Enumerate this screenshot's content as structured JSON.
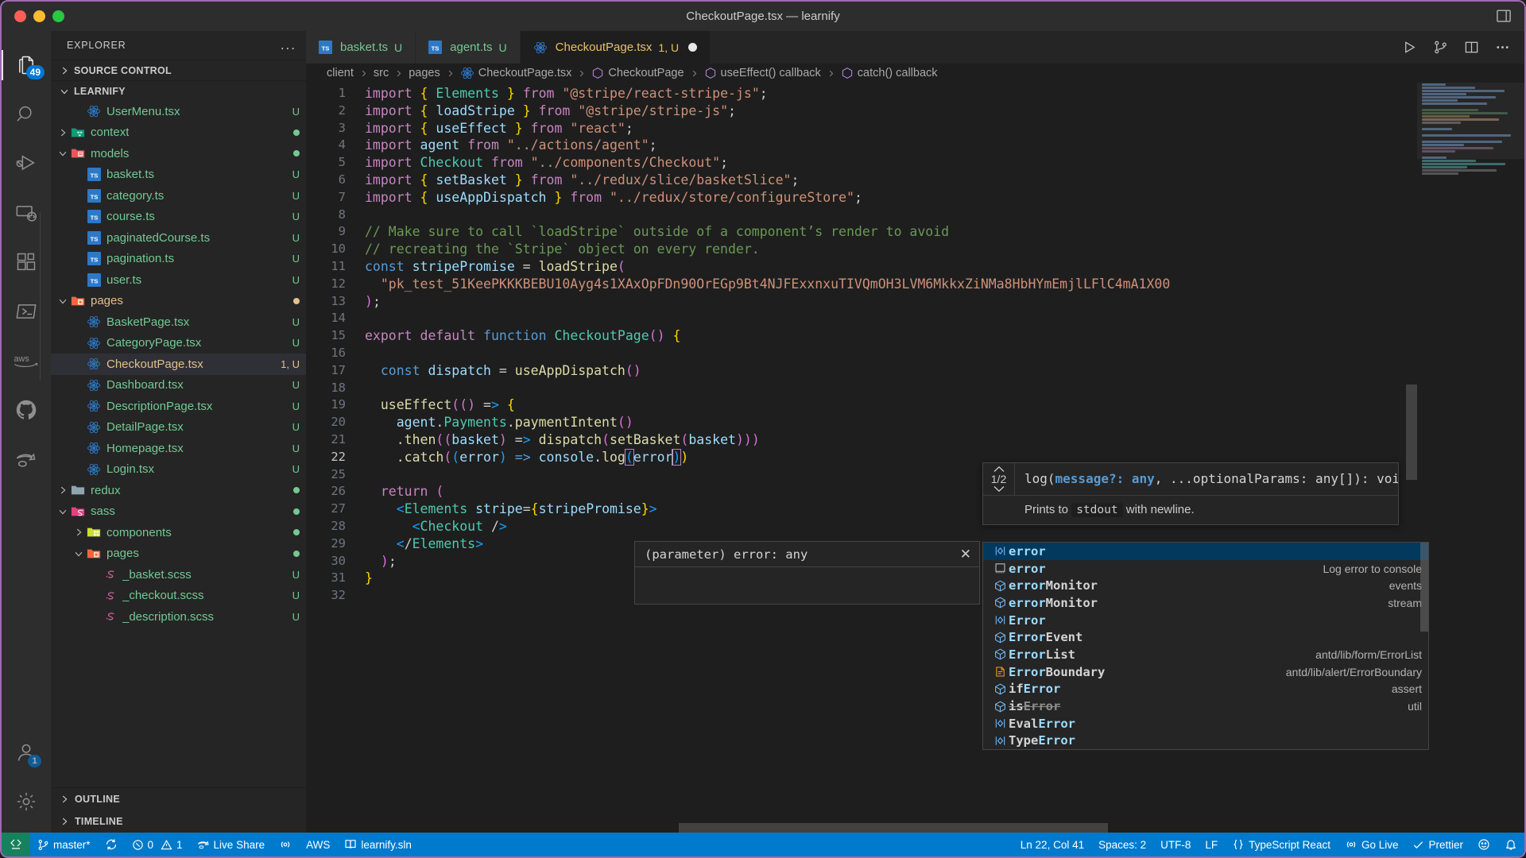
{
  "window": {
    "title": "CheckoutPage.tsx — learnify",
    "traffic_lights": [
      "close",
      "minimize",
      "zoom"
    ],
    "layout_icon": "editor-layout-icon"
  },
  "activitybar": {
    "items": [
      {
        "name": "explorer",
        "icon": "files-icon",
        "badge": "49",
        "active": true
      },
      {
        "name": "search",
        "icon": "search-icon",
        "badge": ""
      },
      {
        "name": "run-and-debug",
        "icon": "debug-icon",
        "badge": ""
      },
      {
        "name": "remote-explorer",
        "icon": "remote-icon",
        "badge": ""
      },
      {
        "name": "extensions",
        "icon": "extensions-icon",
        "badge": ""
      },
      {
        "name": "terminal-tools",
        "icon": "powershell-icon",
        "badge": ""
      },
      {
        "name": "aws-toolkit",
        "icon": "aws-icon",
        "badge": ""
      },
      {
        "name": "github",
        "icon": "github-icon",
        "badge": ""
      },
      {
        "name": "live-share",
        "icon": "live-share-icon",
        "badge": ""
      }
    ],
    "bottom": [
      {
        "name": "accounts",
        "icon": "account-icon",
        "badge": "1"
      },
      {
        "name": "manage-settings",
        "icon": "gear-icon",
        "badge": ""
      }
    ]
  },
  "sidebar": {
    "title": "EXPLORER",
    "more_actions": "...",
    "sections": [
      {
        "label": "SOURCE CONTROL",
        "expanded": false
      },
      {
        "label": "LEARNIFY",
        "expanded": true
      }
    ],
    "tree": [
      {
        "label": "UserMenu.tsx",
        "icon": "react-icon",
        "indent": 3,
        "twisty": "",
        "status": "U",
        "color": "green"
      },
      {
        "label": "context",
        "icon": "folder-context-icon",
        "indent": 2,
        "twisty": "collapsed",
        "status": "dot",
        "color": "green"
      },
      {
        "label": "models",
        "icon": "folder-models-icon",
        "indent": 2,
        "twisty": "expanded",
        "status": "dot",
        "color": "green"
      },
      {
        "label": "basket.ts",
        "icon": "ts-icon",
        "indent": 3,
        "twisty": "",
        "status": "U",
        "color": "green"
      },
      {
        "label": "category.ts",
        "icon": "ts-icon",
        "indent": 3,
        "twisty": "",
        "status": "U",
        "color": "green"
      },
      {
        "label": "course.ts",
        "icon": "ts-icon",
        "indent": 3,
        "twisty": "",
        "status": "U",
        "color": "green"
      },
      {
        "label": "paginatedCourse.ts",
        "icon": "ts-icon",
        "indent": 3,
        "twisty": "",
        "status": "U",
        "color": "green"
      },
      {
        "label": "pagination.ts",
        "icon": "ts-icon",
        "indent": 3,
        "twisty": "",
        "status": "U",
        "color": "green"
      },
      {
        "label": "user.ts",
        "icon": "ts-icon",
        "indent": 3,
        "twisty": "",
        "status": "U",
        "color": "green"
      },
      {
        "label": "pages",
        "icon": "folder-pages-icon",
        "indent": 2,
        "twisty": "expanded",
        "status": "dot-orange",
        "color": "orange"
      },
      {
        "label": "BasketPage.tsx",
        "icon": "react-icon",
        "indent": 3,
        "twisty": "",
        "status": "U",
        "color": "green"
      },
      {
        "label": "CategoryPage.tsx",
        "icon": "react-icon",
        "indent": 3,
        "twisty": "",
        "status": "U",
        "color": "green"
      },
      {
        "label": "CheckoutPage.tsx",
        "icon": "react-icon",
        "indent": 3,
        "twisty": "",
        "status": "1, U",
        "color": "orange",
        "selected": true
      },
      {
        "label": "Dashboard.tsx",
        "icon": "react-icon",
        "indent": 3,
        "twisty": "",
        "status": "U",
        "color": "green"
      },
      {
        "label": "DescriptionPage.tsx",
        "icon": "react-icon",
        "indent": 3,
        "twisty": "",
        "status": "U",
        "color": "green"
      },
      {
        "label": "DetailPage.tsx",
        "icon": "react-icon",
        "indent": 3,
        "twisty": "",
        "status": "U",
        "color": "green"
      },
      {
        "label": "Homepage.tsx",
        "icon": "react-icon",
        "indent": 3,
        "twisty": "",
        "status": "U",
        "color": "green"
      },
      {
        "label": "Login.tsx",
        "icon": "react-icon",
        "indent": 3,
        "twisty": "",
        "status": "U",
        "color": "green"
      },
      {
        "label": "redux",
        "icon": "folder-plain-icon",
        "indent": 2,
        "twisty": "collapsed",
        "status": "dot",
        "color": "green"
      },
      {
        "label": "sass",
        "icon": "folder-sass-icon",
        "indent": 2,
        "twisty": "expanded",
        "status": "dot",
        "color": "green"
      },
      {
        "label": "components",
        "icon": "folder-components-icon",
        "indent": 3,
        "twisty": "collapsed",
        "status": "dot",
        "color": "green"
      },
      {
        "label": "pages",
        "icon": "folder-pages2-icon",
        "indent": 3,
        "twisty": "expanded",
        "status": "dot",
        "color": "green"
      },
      {
        "label": "_basket.scss",
        "icon": "sass-icon",
        "indent": 4,
        "twisty": "",
        "status": "U",
        "color": "green"
      },
      {
        "label": "_checkout.scss",
        "icon": "sass-icon",
        "indent": 4,
        "twisty": "",
        "status": "U",
        "color": "green"
      },
      {
        "label": "_description.scss",
        "icon": "sass-icon",
        "indent": 4,
        "twisty": "",
        "status": "U",
        "color": "green"
      }
    ],
    "footer": [
      {
        "label": "OUTLINE",
        "expanded": false
      },
      {
        "label": "TIMELINE",
        "expanded": false
      }
    ]
  },
  "tabs": {
    "items": [
      {
        "name": "basket.ts",
        "icon": "ts-icon",
        "status": "U",
        "active": false,
        "dirty": false
      },
      {
        "name": "agent.ts",
        "icon": "ts-icon",
        "status": "U",
        "active": false,
        "dirty": false
      },
      {
        "name": "CheckoutPage.tsx",
        "icon": "react-icon",
        "status": "1, U",
        "active": true,
        "dirty": true
      }
    ],
    "actions": [
      {
        "name": "run-code-button",
        "icon": "play-icon"
      },
      {
        "name": "source-control-button",
        "icon": "branch-icon"
      },
      {
        "name": "split-editor-button",
        "icon": "split-icon"
      },
      {
        "name": "more-actions-button",
        "icon": "ellipsis-icon"
      }
    ]
  },
  "breadcrumb": [
    {
      "label": "client",
      "icon": ""
    },
    {
      "label": "src",
      "icon": ""
    },
    {
      "label": "pages",
      "icon": ""
    },
    {
      "label": "CheckoutPage.tsx",
      "icon": "react-icon"
    },
    {
      "label": "CheckoutPage",
      "icon": "symbol-function-icon"
    },
    {
      "label": "useEffect() callback",
      "icon": "symbol-function-icon"
    },
    {
      "label": "catch() callback",
      "icon": "symbol-function-icon"
    }
  ],
  "code": {
    "lines": [
      {
        "n": "1",
        "text": "import { Elements } from \"@stripe/react-stripe-js\";"
      },
      {
        "n": "2",
        "text": "import { loadStripe } from \"@stripe/stripe-js\";"
      },
      {
        "n": "3",
        "text": "import { useEffect } from \"react\";"
      },
      {
        "n": "4",
        "text": "import agent from \"../actions/agent\";"
      },
      {
        "n": "5",
        "text": "import Checkout from \"../components/Checkout\";"
      },
      {
        "n": "6",
        "text": "import { setBasket } from \"../redux/slice/basketSlice\";"
      },
      {
        "n": "7",
        "text": "import { useAppDispatch } from \"../redux/store/configureStore\";"
      },
      {
        "n": "8",
        "text": ""
      },
      {
        "n": "9",
        "text": "// Make sure to call `loadStripe` outside of a component’s render to avoid"
      },
      {
        "n": "10",
        "text": "// recreating the `Stripe` object on every render."
      },
      {
        "n": "11",
        "text": "const stripePromise = loadStripe("
      },
      {
        "n": "12",
        "text": "  \"pk_test_51KeePKKKBEBU10Ayg4s1XAxOpFDn90OrEGp9Bt4NJFExxnxuTIVQmOH3LVM6MkkxZiNMa8HbHYmEmjlLFlC4mA1X00"
      },
      {
        "n": "13",
        "text": ");"
      },
      {
        "n": "14",
        "text": ""
      },
      {
        "n": "15",
        "text": "export default function CheckoutPage() {"
      },
      {
        "n": "16",
        "text": ""
      },
      {
        "n": "17",
        "text": "  const dispatch = useAppDispatch()"
      },
      {
        "n": "18",
        "text": ""
      },
      {
        "n": "19",
        "text": "  useEffect(() => {"
      },
      {
        "n": "20",
        "text": "    agent.Payments.paymentIntent()"
      },
      {
        "n": "21",
        "text": "    .then((basket) => dispatch(setBasket(basket)))"
      },
      {
        "n": "22",
        "text": "    .catch((error) => console.log(error))"
      },
      {
        "n": "25",
        "text": ""
      },
      {
        "n": "26",
        "text": "  return ("
      },
      {
        "n": "27",
        "text": "    <Elements stripe={stripePromise}>"
      },
      {
        "n": "28",
        "text": "      <Checkout />"
      },
      {
        "n": "29",
        "text": "    </Elements>"
      },
      {
        "n": "30",
        "text": "  );"
      },
      {
        "n": "31",
        "text": "}"
      },
      {
        "n": "32",
        "text": ""
      }
    ]
  },
  "signature_help": {
    "page": "1/2",
    "signature": "log(message?: any, ...optionalParams: any[]): void",
    "doc_prefix": "Prints to",
    "doc_code": "stdout",
    "doc_suffix": "with newline.",
    "prev_icon": "chevron-up-icon",
    "next_icon": "chevron-down-icon"
  },
  "parameter_hint": {
    "text": "(parameter) error: any",
    "close_icon": "close-icon"
  },
  "suggestions": {
    "items": [
      {
        "label": "error",
        "match": "error",
        "detail": "",
        "icon": "symbol-variable-icon",
        "selected": true
      },
      {
        "label": "error",
        "match": "error",
        "detail": "Log error to console",
        "icon": "symbol-snippet-icon"
      },
      {
        "label": "errorMonitor",
        "match": "error",
        "detail": "events",
        "icon": "symbol-module-icon"
      },
      {
        "label": "errorMonitor",
        "match": "error",
        "detail": "stream",
        "icon": "symbol-module-icon"
      },
      {
        "label": "Error",
        "match": "Error",
        "detail": "",
        "icon": "symbol-variable-icon"
      },
      {
        "label": "ErrorEvent",
        "match": "Error",
        "detail": "",
        "icon": "symbol-module-icon"
      },
      {
        "label": "ErrorList",
        "match": "Error",
        "detail": "antd/lib/form/ErrorList",
        "icon": "symbol-module-icon"
      },
      {
        "label": "ErrorBoundary",
        "match": "Error",
        "detail": "antd/lib/alert/ErrorBoundary",
        "icon": "symbol-class-icon"
      },
      {
        "label": "ifError",
        "match": "Error",
        "detail": "assert",
        "icon": "symbol-module-icon"
      },
      {
        "label": "isError",
        "match": "Error",
        "detail": "util",
        "icon": "symbol-module-icon",
        "deprecated": true
      },
      {
        "label": "EvalError",
        "match": "Error",
        "detail": "",
        "icon": "symbol-variable-icon"
      },
      {
        "label": "TypeError",
        "match": "Error",
        "detail": "",
        "icon": "symbol-variable-icon"
      }
    ]
  },
  "statusbar": {
    "remote": {
      "icon": "remote-icon",
      "label": ""
    },
    "left": [
      {
        "name": "branch",
        "icon": "branch-icon",
        "label": "master*"
      },
      {
        "name": "sync",
        "icon": "sync-icon",
        "label": ""
      },
      {
        "name": "problems",
        "icon": "error-icon",
        "label": "0  1"
      },
      {
        "name": "live-share",
        "icon": "live-share-icon",
        "label": "Live Share"
      },
      {
        "name": "ports",
        "icon": "radio-icon",
        "label": ""
      },
      {
        "name": "aws",
        "icon": "",
        "label": "AWS"
      },
      {
        "name": "solution",
        "icon": "book-icon",
        "label": "learnify.sln"
      }
    ],
    "problems": {
      "errors": "0",
      "warnings": "1"
    },
    "right": [
      {
        "name": "cursor-position",
        "label": "Ln 22, Col 41"
      },
      {
        "name": "indentation",
        "label": "Spaces: 2"
      },
      {
        "name": "encoding",
        "label": "UTF-8"
      },
      {
        "name": "eol",
        "label": "LF"
      },
      {
        "name": "language-mode",
        "label": "TypeScript React",
        "icon": "braces-icon"
      },
      {
        "name": "go-live",
        "label": "Go Live",
        "icon": "broadcast-icon"
      },
      {
        "name": "prettier",
        "label": "Prettier",
        "icon": "check-icon"
      },
      {
        "name": "feedback",
        "label": "",
        "icon": "smiley-icon"
      },
      {
        "name": "notifications",
        "label": "",
        "icon": "bell-icon"
      }
    ]
  },
  "colors": {
    "accent": "#007acc",
    "badge": "#0078d4",
    "modified": "#e2c08d",
    "untracked": "#73c991",
    "selection": "#04395e",
    "remote": "#16825d"
  }
}
